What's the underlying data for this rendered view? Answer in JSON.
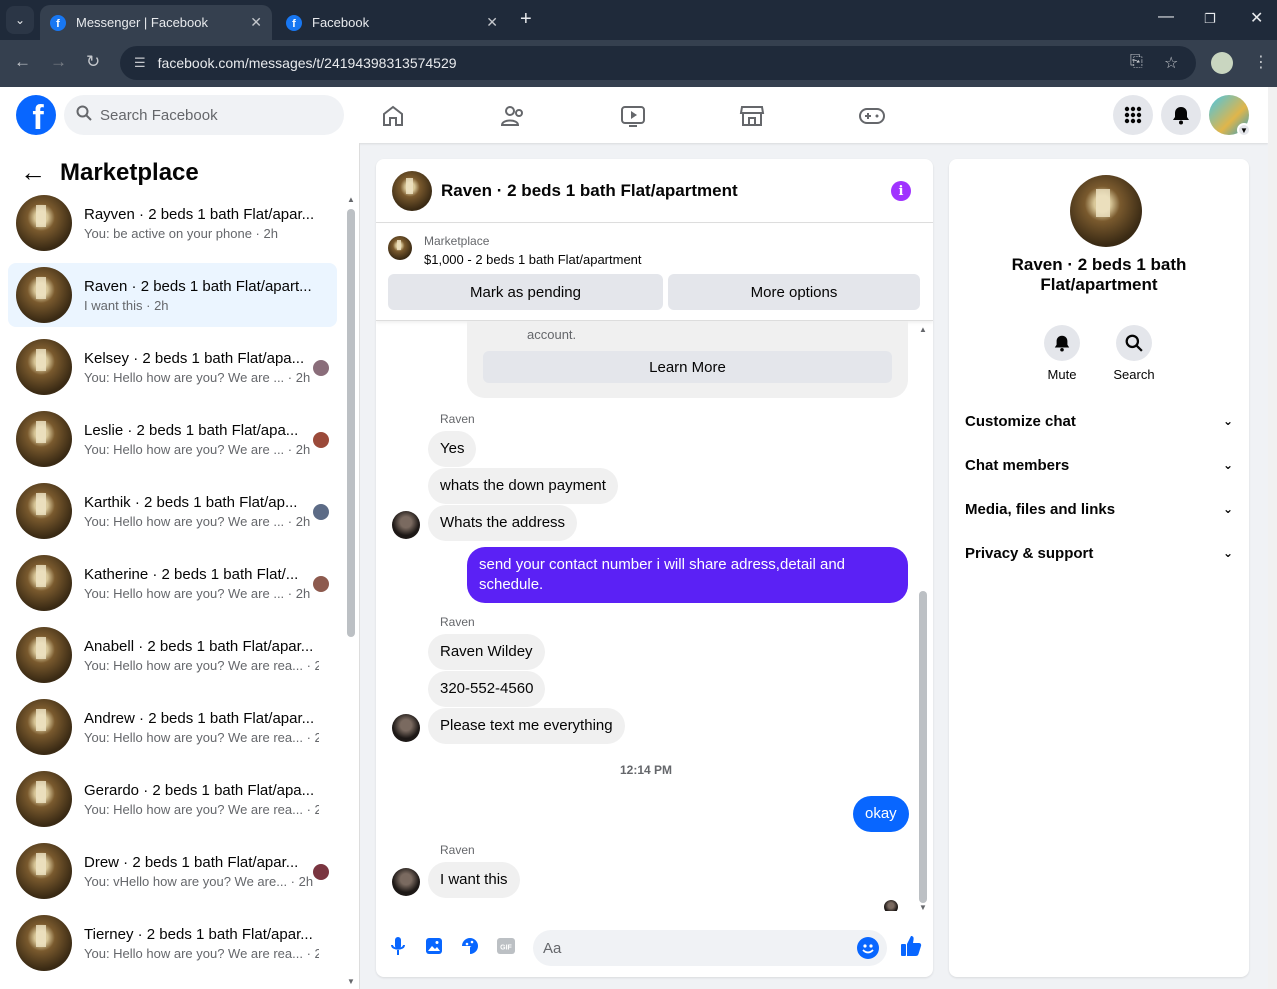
{
  "browser": {
    "tabs": [
      {
        "title": "Messenger | Facebook",
        "active": true
      },
      {
        "title": "Facebook",
        "active": false
      }
    ],
    "url": "facebook.com/messages/t/24194398313574529"
  },
  "header": {
    "logo_letter": "f",
    "search_placeholder": "Search Facebook"
  },
  "left": {
    "title": "Marketplace",
    "conversations": [
      {
        "name": "Rayven · 2 beds 1 bath Flat/apar...",
        "preview": "You: be active on your phone · 2h"
      },
      {
        "name": "Raven · 2 beds 1 bath Flat/apart...",
        "preview": "I want this · 2h",
        "selected": true
      },
      {
        "name": "Kelsey · 2 beds 1 bath Flat/apa...",
        "preview": "You: Hello how are you? We are ... · 2h"
      },
      {
        "name": "Leslie · 2 beds 1 bath Flat/apa...",
        "preview": "You: Hello how are you? We are ... · 2h"
      },
      {
        "name": "Karthik · 2 beds 1 bath Flat/ap...",
        "preview": "You: Hello how are you? We are ... · 2h"
      },
      {
        "name": "Katherine · 2 beds 1 bath Flat/...",
        "preview": "You: Hello how are you? We are ... · 2h"
      },
      {
        "name": "Anabell · 2 beds 1 bath Flat/apar...",
        "preview": "You: Hello how are you? We are rea... · 2h"
      },
      {
        "name": "Andrew · 2 beds 1 bath Flat/apar...",
        "preview": "You: Hello how are you? We are rea... · 2h"
      },
      {
        "name": "Gerardo · 2 beds 1 bath Flat/apa...",
        "preview": "You: Hello how are you? We are rea... · 2h"
      },
      {
        "name": "Drew · 2 beds 1 bath Flat/apar...",
        "preview": "You: vHello how are you? We are... · 2h"
      },
      {
        "name": "Tierney · 2 beds 1 bath Flat/apar...",
        "preview": "You: Hello how are you? We are rea... · 2h"
      }
    ]
  },
  "chat": {
    "title": "Raven · 2 beds 1 bath Flat/apartment",
    "info_glyph": "i",
    "marketplace_label": "Marketplace",
    "listing": "$1,000 - 2 beds 1 bath Flat/apartment",
    "mark_pending": "Mark as pending",
    "more_options": "More options",
    "card_text": "account.",
    "learn_more": "Learn More",
    "sender": "Raven",
    "msgs1": [
      "Yes",
      "whats the down payment",
      "Whats the address"
    ],
    "my_msg": "send your contact number i will share adress,detail and schedule.",
    "msgs2": [
      "Raven Wildey",
      "320-552-4560",
      "Please text me everything"
    ],
    "timestamp": "12:14 PM",
    "okay": "okay",
    "last": "I want this",
    "compose_placeholder": "Aa"
  },
  "right": {
    "name": "Raven · 2 beds 1 bath Flat/apartment",
    "mute": "Mute",
    "search": "Search",
    "sections": [
      "Customize chat",
      "Chat members",
      "Media, files and links",
      "Privacy & support"
    ]
  },
  "colors": {
    "brand": "#0866ff",
    "accent_purple": "#5b21f5",
    "info": "#a033ff"
  }
}
